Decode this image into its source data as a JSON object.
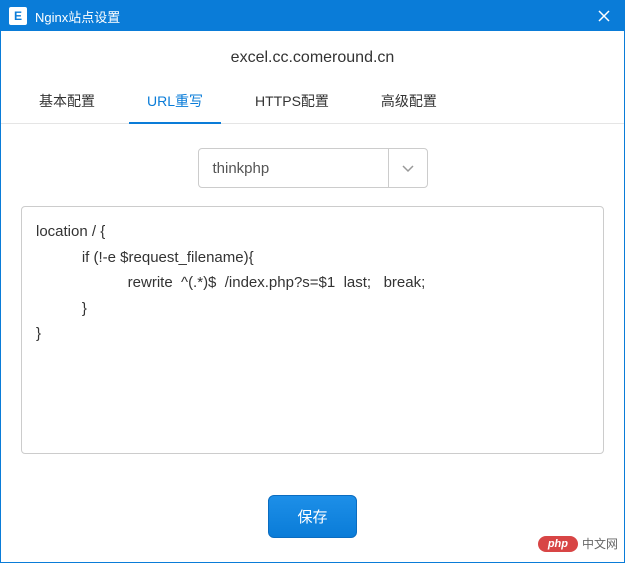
{
  "window": {
    "icon_letter": "E",
    "title": "Nginx站点设置"
  },
  "header": {
    "site": "excel.cc.comeround.cn"
  },
  "tabs": [
    {
      "label": "基本配置",
      "active": false
    },
    {
      "label": "URL重写",
      "active": true
    },
    {
      "label": "HTTPS配置",
      "active": false
    },
    {
      "label": "高级配置",
      "active": false
    }
  ],
  "url_rewrite": {
    "template_selected": "thinkphp",
    "code": "location / {\n           if (!-e $request_filename){\n                      rewrite  ^(.*)$  /index.php?s=$1  last;   break;\n           }\n}"
  },
  "footer": {
    "save_label": "保存"
  },
  "watermark": {
    "pill": "php",
    "text": "中文网"
  }
}
